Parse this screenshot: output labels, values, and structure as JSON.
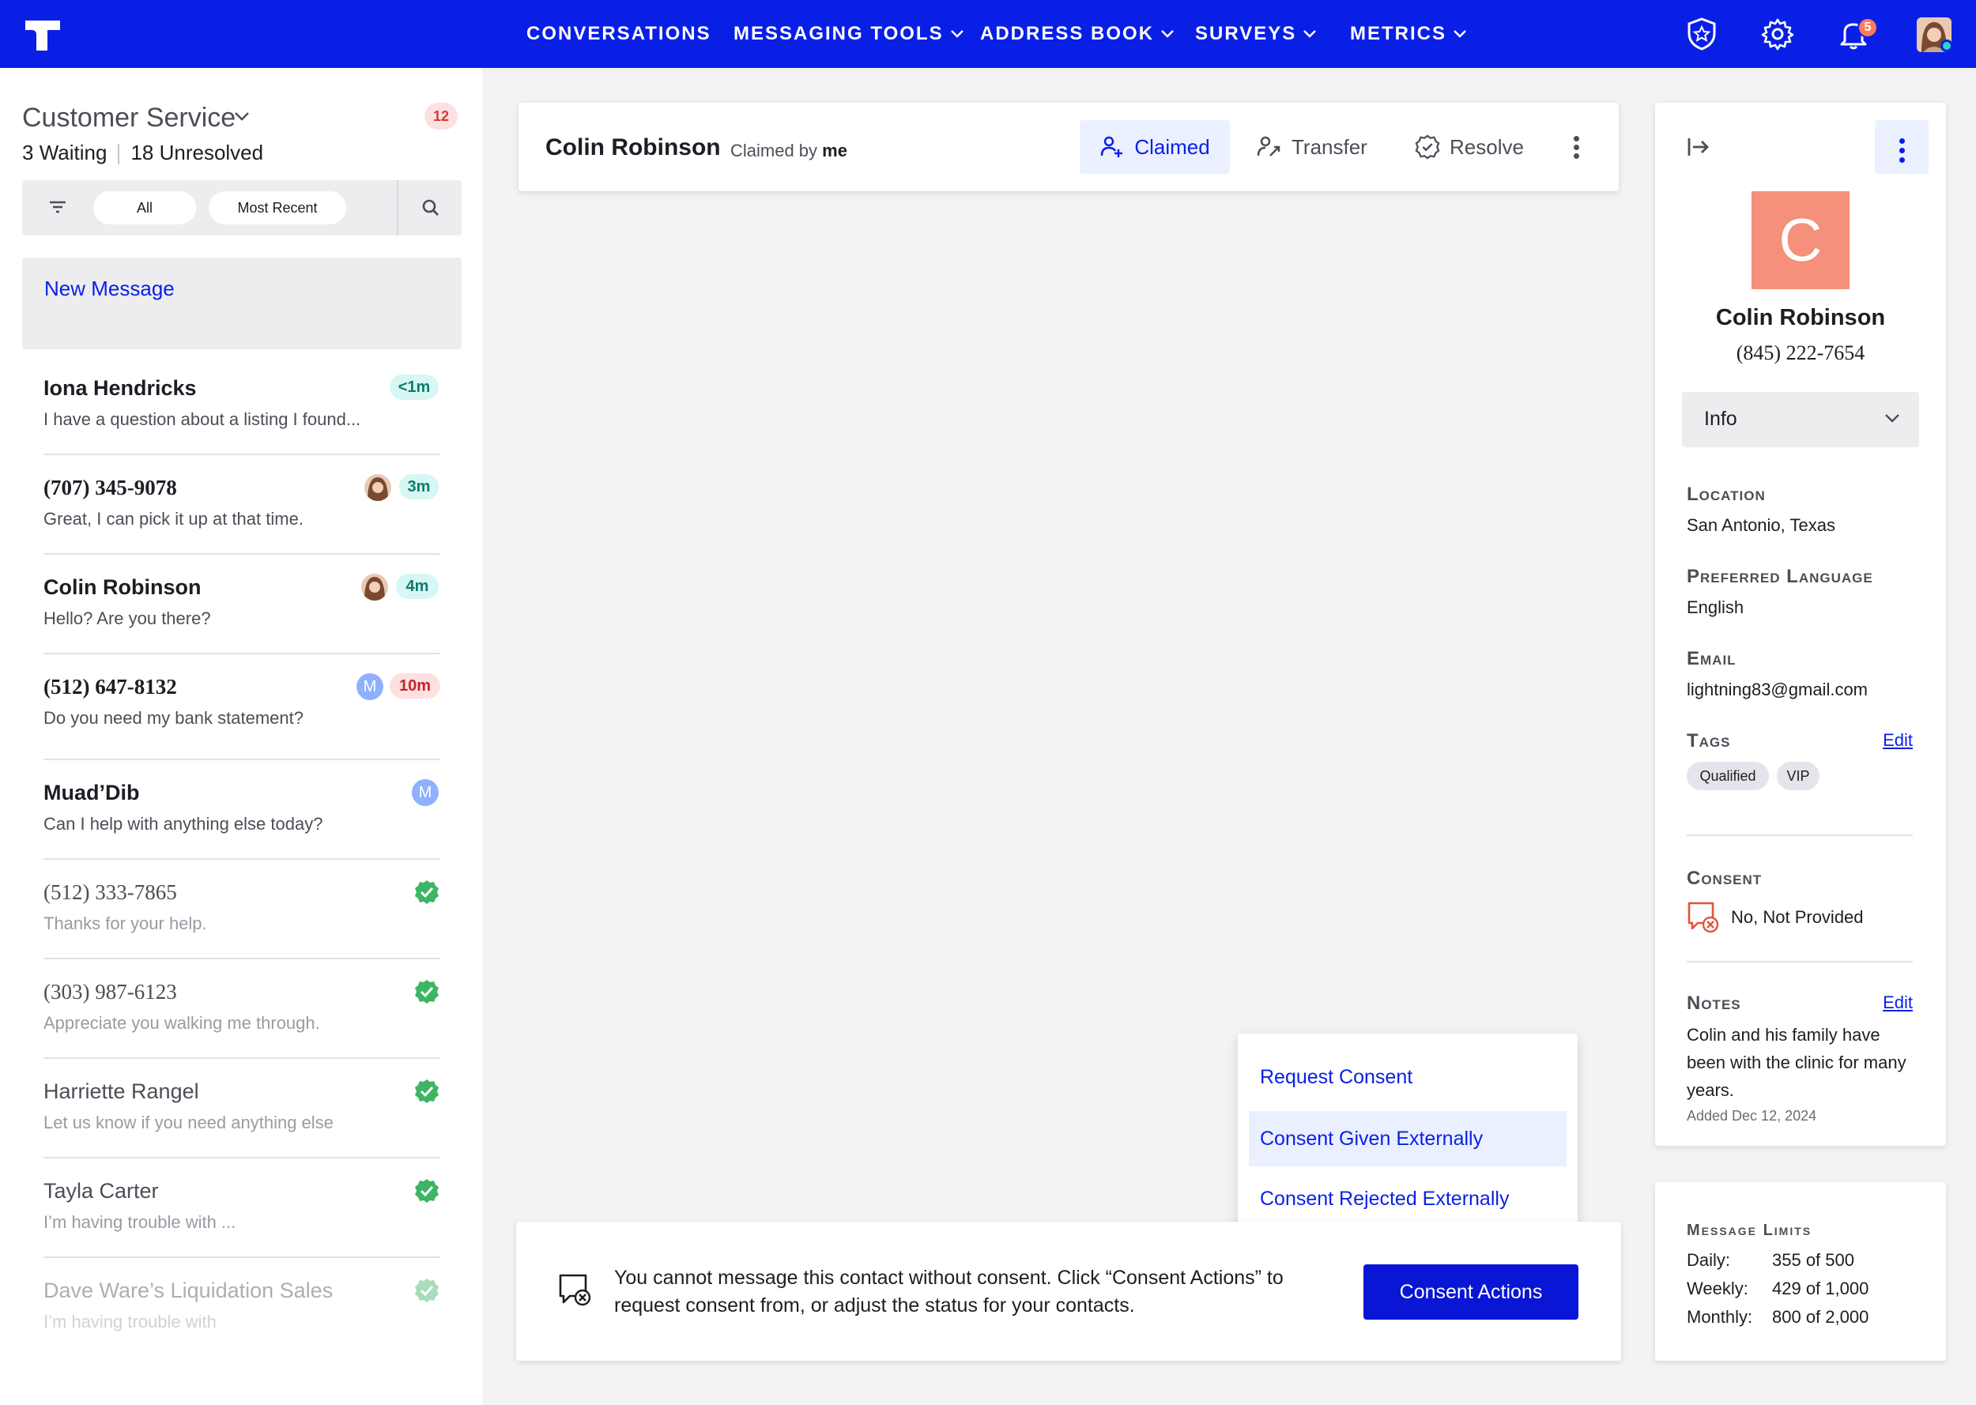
{
  "nav": {
    "items": [
      {
        "label": "Conversations",
        "has_dropdown": false
      },
      {
        "label": "Messaging Tools",
        "has_dropdown": true
      },
      {
        "label": "Address Book",
        "has_dropdown": true
      },
      {
        "label": "Surveys",
        "has_dropdown": true
      },
      {
        "label": "Metrics",
        "has_dropdown": true
      }
    ],
    "icons": [
      "shield-star-icon",
      "gear-icon",
      "bell-icon",
      "user-avatar"
    ],
    "notification_count": "5",
    "colors": {
      "bar": "#0a1fe6"
    }
  },
  "sidebar": {
    "team_name": "Customer Service",
    "team_badge": "12",
    "waiting_count": "3",
    "waiting_label": "Waiting",
    "unresolved_count": "18",
    "unresolved_label": "Unresolved",
    "filter_all": "All",
    "filter_recent": "Most Recent",
    "new_message": "New Message",
    "conversations": [
      {
        "name": "Iona Hendricks",
        "preview": "I have a question about a listing I found...",
        "time": "<1m",
        "status": "waiting"
      },
      {
        "name": "(707) 345-9078",
        "preview": "Great, I can pick it up at that time.",
        "time": "3m",
        "status": "claimed"
      },
      {
        "name": "Colin Robinson",
        "preview": "Hello? Are you there?",
        "time": "4m",
        "status": "claimed"
      },
      {
        "name": "(512) 647-8132",
        "preview": "Do you need my bank statement?",
        "time": "10m",
        "assignee": "M",
        "status": "overdue"
      },
      {
        "name": "Muad’Dib",
        "preview": "Can I help with anything else today?",
        "assignee": "M",
        "status": "assigned"
      },
      {
        "name": "(512) 333-7865",
        "preview": "Thanks for your help.",
        "status": "resolved"
      },
      {
        "name": "(303) 987-6123",
        "preview": "Appreciate you walking me through.",
        "status": "resolved"
      },
      {
        "name": "Harriette Rangel",
        "preview": "Let us know if you need anything else",
        "status": "resolved"
      },
      {
        "name": "Tayla Carter",
        "preview": "I’m having trouble with ...",
        "status": "resolved"
      },
      {
        "name": "Dave Ware’s Liquidation Sales",
        "preview": "I’m having trouble with",
        "status": "resolved"
      }
    ]
  },
  "conversation": {
    "contact_name": "Colin Robinson",
    "claimed_by_prefix": "Claimed by",
    "claimed_by": "me",
    "claimed_label": "Claimed",
    "transfer_label": "Transfer",
    "resolve_label": "Resolve"
  },
  "consent_bar": {
    "message": "You cannot message this contact without consent. Click “Consent Actions” to request consent from, or adjust the status for your contacts.",
    "button": "Consent Actions"
  },
  "consent_menu": {
    "items": [
      "Request Consent",
      "Consent Given Externally",
      "Consent Rejected Externally"
    ],
    "highlighted": "Consent Given Externally"
  },
  "profile": {
    "avatar_letter": "C",
    "name": "Colin Robinson",
    "phone": "(845) 222-7654",
    "section_select": "Info",
    "location_label": "Location",
    "location": "San Antonio, Texas",
    "language_label": "Preferred Language",
    "language": "English",
    "email_label": "Email",
    "email": "lightning83@gmail.com",
    "tags_label": "Tags",
    "tags_edit": "Edit",
    "tags": [
      "Qualified",
      "VIP"
    ],
    "consent_label": "Consent",
    "consent_status": "No, Not Provided",
    "notes_label": "Notes",
    "notes_edit": "Edit",
    "notes": "Colin and his family have been with the clinic for many years.",
    "notes_added": "Added Dec 12, 2024",
    "colors": {
      "avatar": "#f5907a"
    }
  },
  "limits": {
    "title": "Message Limits",
    "daily_label": "Daily:",
    "daily": "355 of 500",
    "weekly_label": "Weekly:",
    "weekly": "429 of 1,000",
    "monthly_label": "Monthly:",
    "monthly": "800 of 2,000"
  }
}
